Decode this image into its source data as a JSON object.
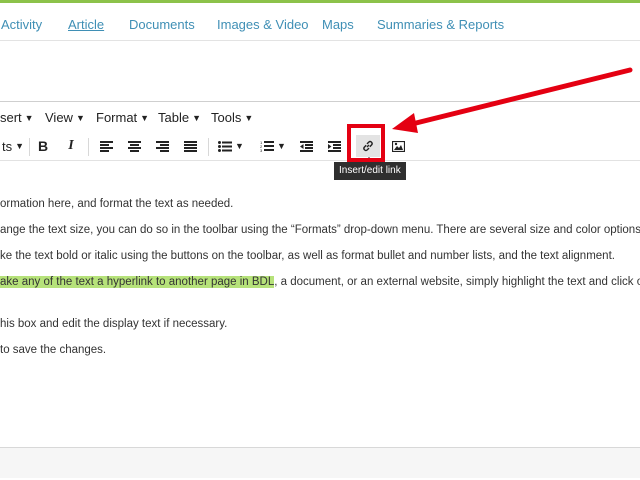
{
  "tabs": [
    {
      "label": "Activity",
      "active": false
    },
    {
      "label": "Article",
      "active": true
    },
    {
      "label": "Documents",
      "active": false
    },
    {
      "label": "Images & Video",
      "active": false
    },
    {
      "label": "Maps",
      "active": false
    },
    {
      "label": "Summaries & Reports",
      "active": false
    }
  ],
  "menubar": {
    "insert": "sert",
    "view": "View",
    "format": "Format",
    "table": "Table",
    "tools": "Tools"
  },
  "toolbar": {
    "formats": "ts",
    "bold": "B",
    "italic": "I",
    "link_tooltip": "Insert/edit link"
  },
  "content": {
    "line1": "ormation here, and format the text as needed.",
    "line2": "ange the text size, you can do so in the toolbar using the “Formats” drop-down menu. There are several size and color options",
    "line3": "ke the text bold or italic using the buttons on the toolbar, as well as format bullet and number lists, and the text alignment.",
    "line4_highlight": "ake any of the text a hyperlink to another page in BDL",
    "line4_rest": ", a document, or an external website, simply highlight the text and click o",
    "line5": "his box and edit the display text if necessary.",
    "line6": "to save the changes."
  },
  "colors": {
    "accent_top": "#8cc24a",
    "tab_link": "#3f8fb5",
    "highlight": "#b6e27a",
    "annotation_red": "#e40012"
  }
}
